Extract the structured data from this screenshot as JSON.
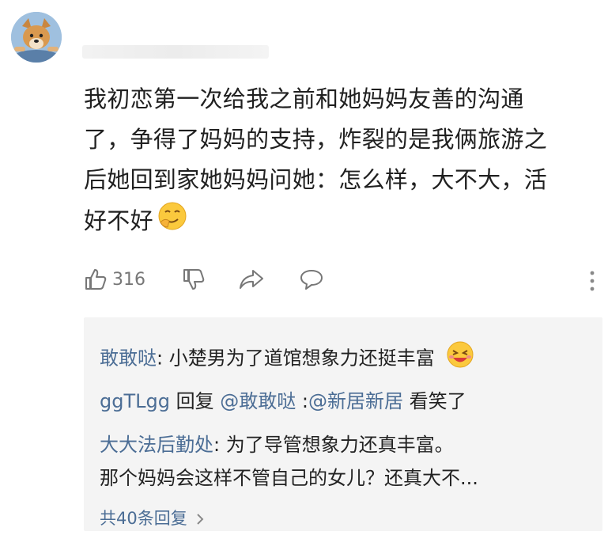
{
  "comment": {
    "lines": [
      "我初恋第一次给我之前和她妈妈友善的沟通",
      "了，争得了妈妈的支持，炸裂的是我俩旅游之",
      "后她回到家她妈妈问她：怎么样，大不大，活",
      "好不好"
    ],
    "emoji": "smirk-emoji",
    "like_count": "316"
  },
  "replies": [
    {
      "name": "敢敢哒",
      "text": ": 小楚男为了道馆想象力还挺丰富",
      "emoji": "laughing-emoji"
    },
    {
      "name": "ggTLgg",
      "middle": " 回复 ",
      "mention1": "@敢敢哒",
      "colon": " :",
      "mention2": "@新居新居",
      "text": " 看笑了"
    },
    {
      "name": "大大法后勤处",
      "text": ": 为了导管想象力还真丰富。",
      "line2": "那个妈妈会这样不管自己的女儿？还真大不..."
    }
  ],
  "more_replies": "共40条回复",
  "icons": [
    "thumb-up-icon",
    "thumb-down-icon",
    "share-icon",
    "comment-icon",
    "more-icon",
    "chevron-right-icon"
  ],
  "colors": {
    "link": "#4b6d95",
    "reply_bg": "#f4f4f4"
  }
}
